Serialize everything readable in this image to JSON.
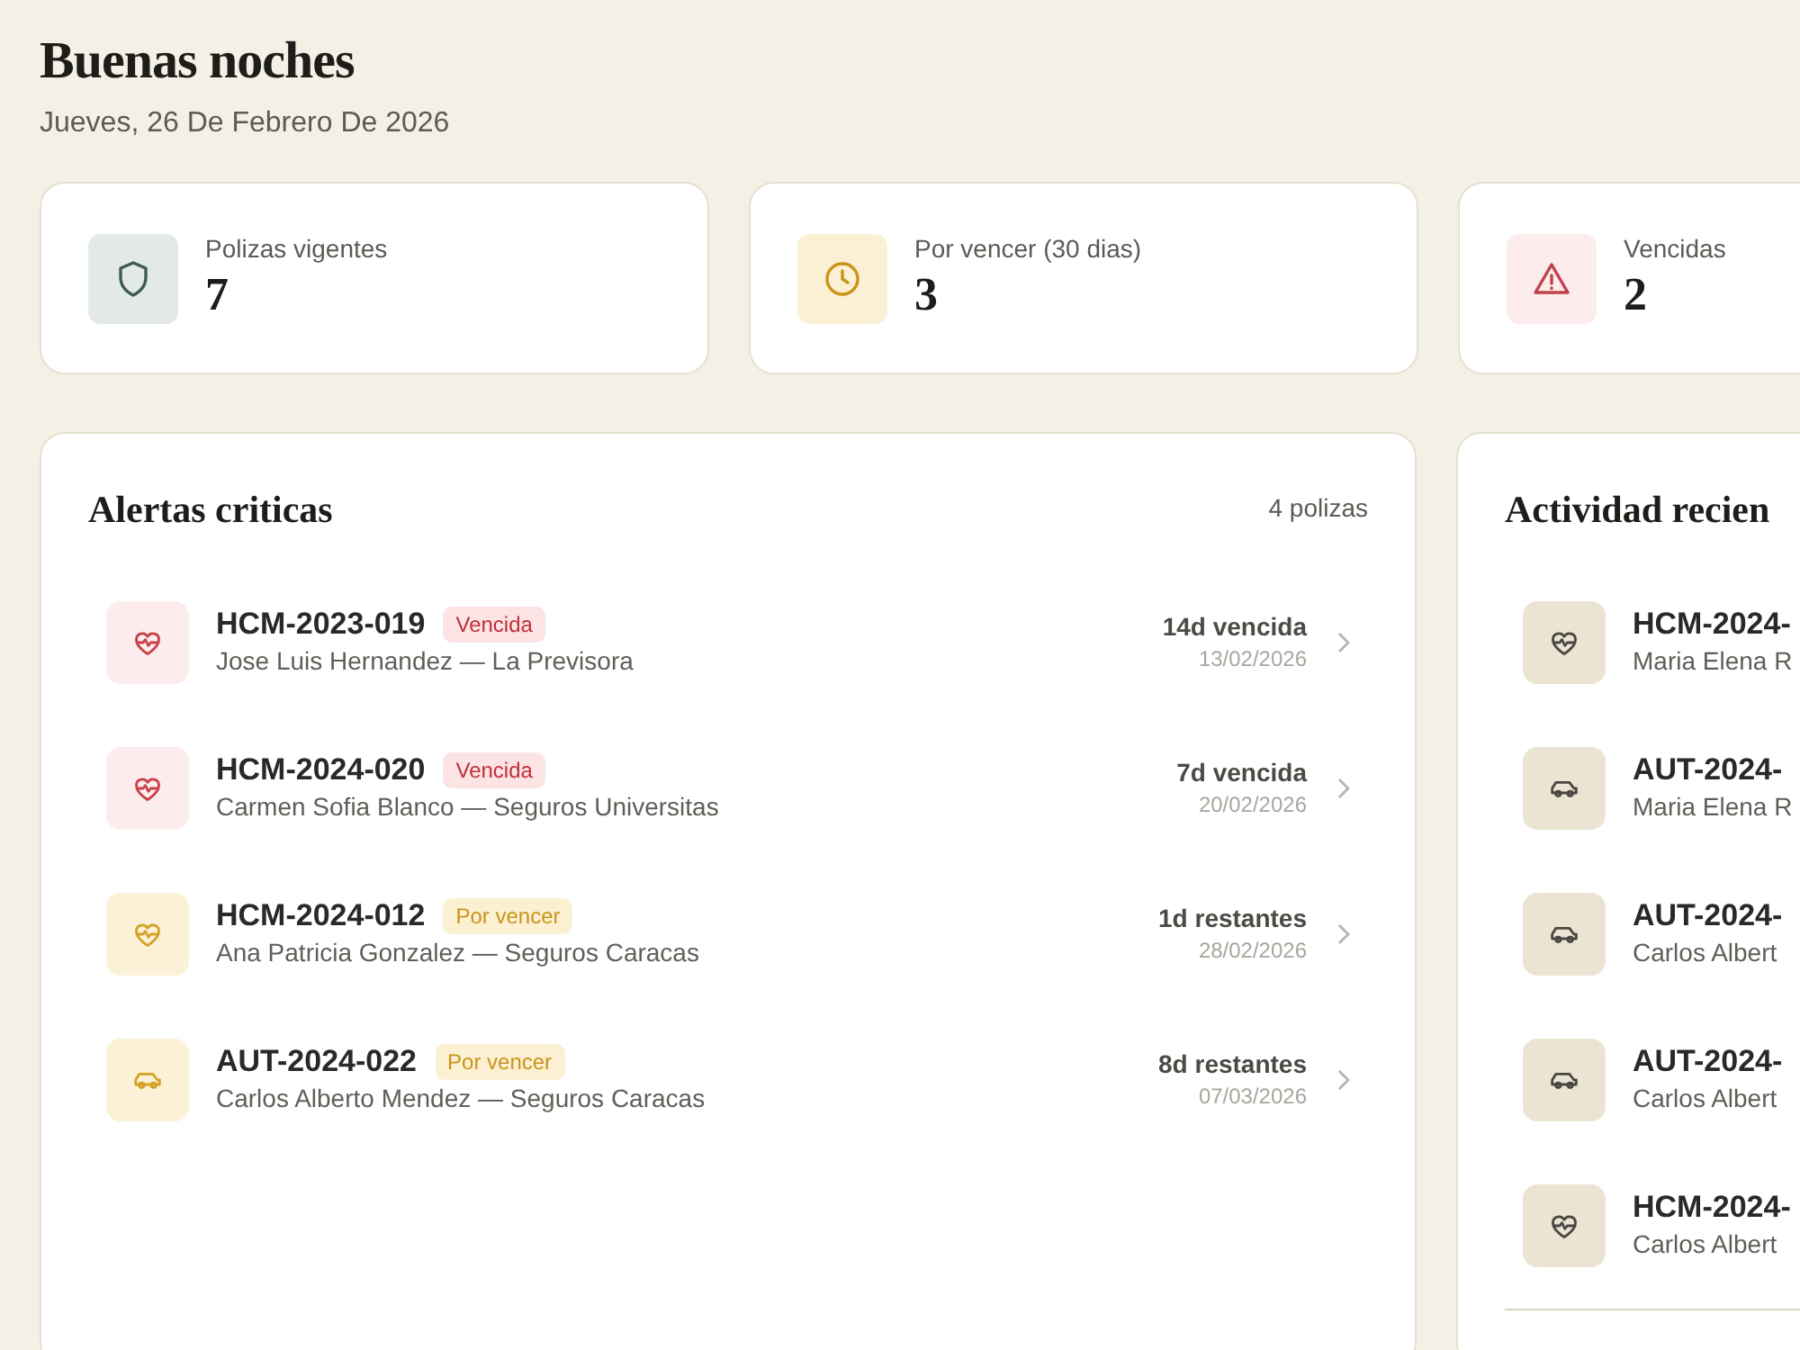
{
  "greeting": "Buenas noches",
  "date": "Jueves, 26 De Febrero De 2026",
  "stats": [
    {
      "kind": "shield",
      "label": "Polizas vigentes",
      "value": "7"
    },
    {
      "kind": "clock",
      "label": "Por vencer (30 dias)",
      "value": "3"
    },
    {
      "kind": "warning",
      "label": "Vencidas",
      "value": "2"
    }
  ],
  "alerts": {
    "title": "Alertas criticas",
    "count": "4 polizas",
    "items": [
      {
        "icon": {
          "kind": "heart"
        },
        "kind": "overdue",
        "code": "HCM-2023-019",
        "badge": "Vencida",
        "client": "Jose Luis Hernandez — La Previsora",
        "remaining": "14d vencida",
        "due": "13/02/2026"
      },
      {
        "icon": {
          "kind": "heart"
        },
        "kind": "overdue",
        "code": "HCM-2024-020",
        "badge": "Vencida",
        "client": "Carmen Sofia Blanco — Seguros Universitas",
        "remaining": "7d vencida",
        "due": "20/02/2026"
      },
      {
        "icon": {
          "kind": "heart"
        },
        "kind": "expiring",
        "code": "HCM-2024-012",
        "badge": "Por vencer",
        "client": "Ana Patricia Gonzalez — Seguros Caracas",
        "remaining": "1d restantes",
        "due": "28/02/2026"
      },
      {
        "icon": {
          "kind": "car"
        },
        "kind": "expiring",
        "code": "AUT-2024-022",
        "badge": "Por vencer",
        "client": "Carlos Alberto Mendez — Seguros Caracas",
        "remaining": "8d restantes",
        "due": "07/03/2026"
      }
    ]
  },
  "activity": {
    "title": "Actividad recien",
    "items": [
      {
        "kind": "heart",
        "code": "HCM-2024-",
        "client": "Maria Elena R"
      },
      {
        "kind": "car",
        "code": "AUT-2024-",
        "client": "Maria Elena R"
      },
      {
        "kind": "car",
        "code": "AUT-2024-",
        "client": "Carlos Albert"
      },
      {
        "kind": "car",
        "code": "AUT-2024-",
        "client": "Carlos Albert"
      },
      {
        "kind": "heart",
        "code": "HCM-2024-",
        "client": "Carlos Albert"
      }
    ]
  }
}
